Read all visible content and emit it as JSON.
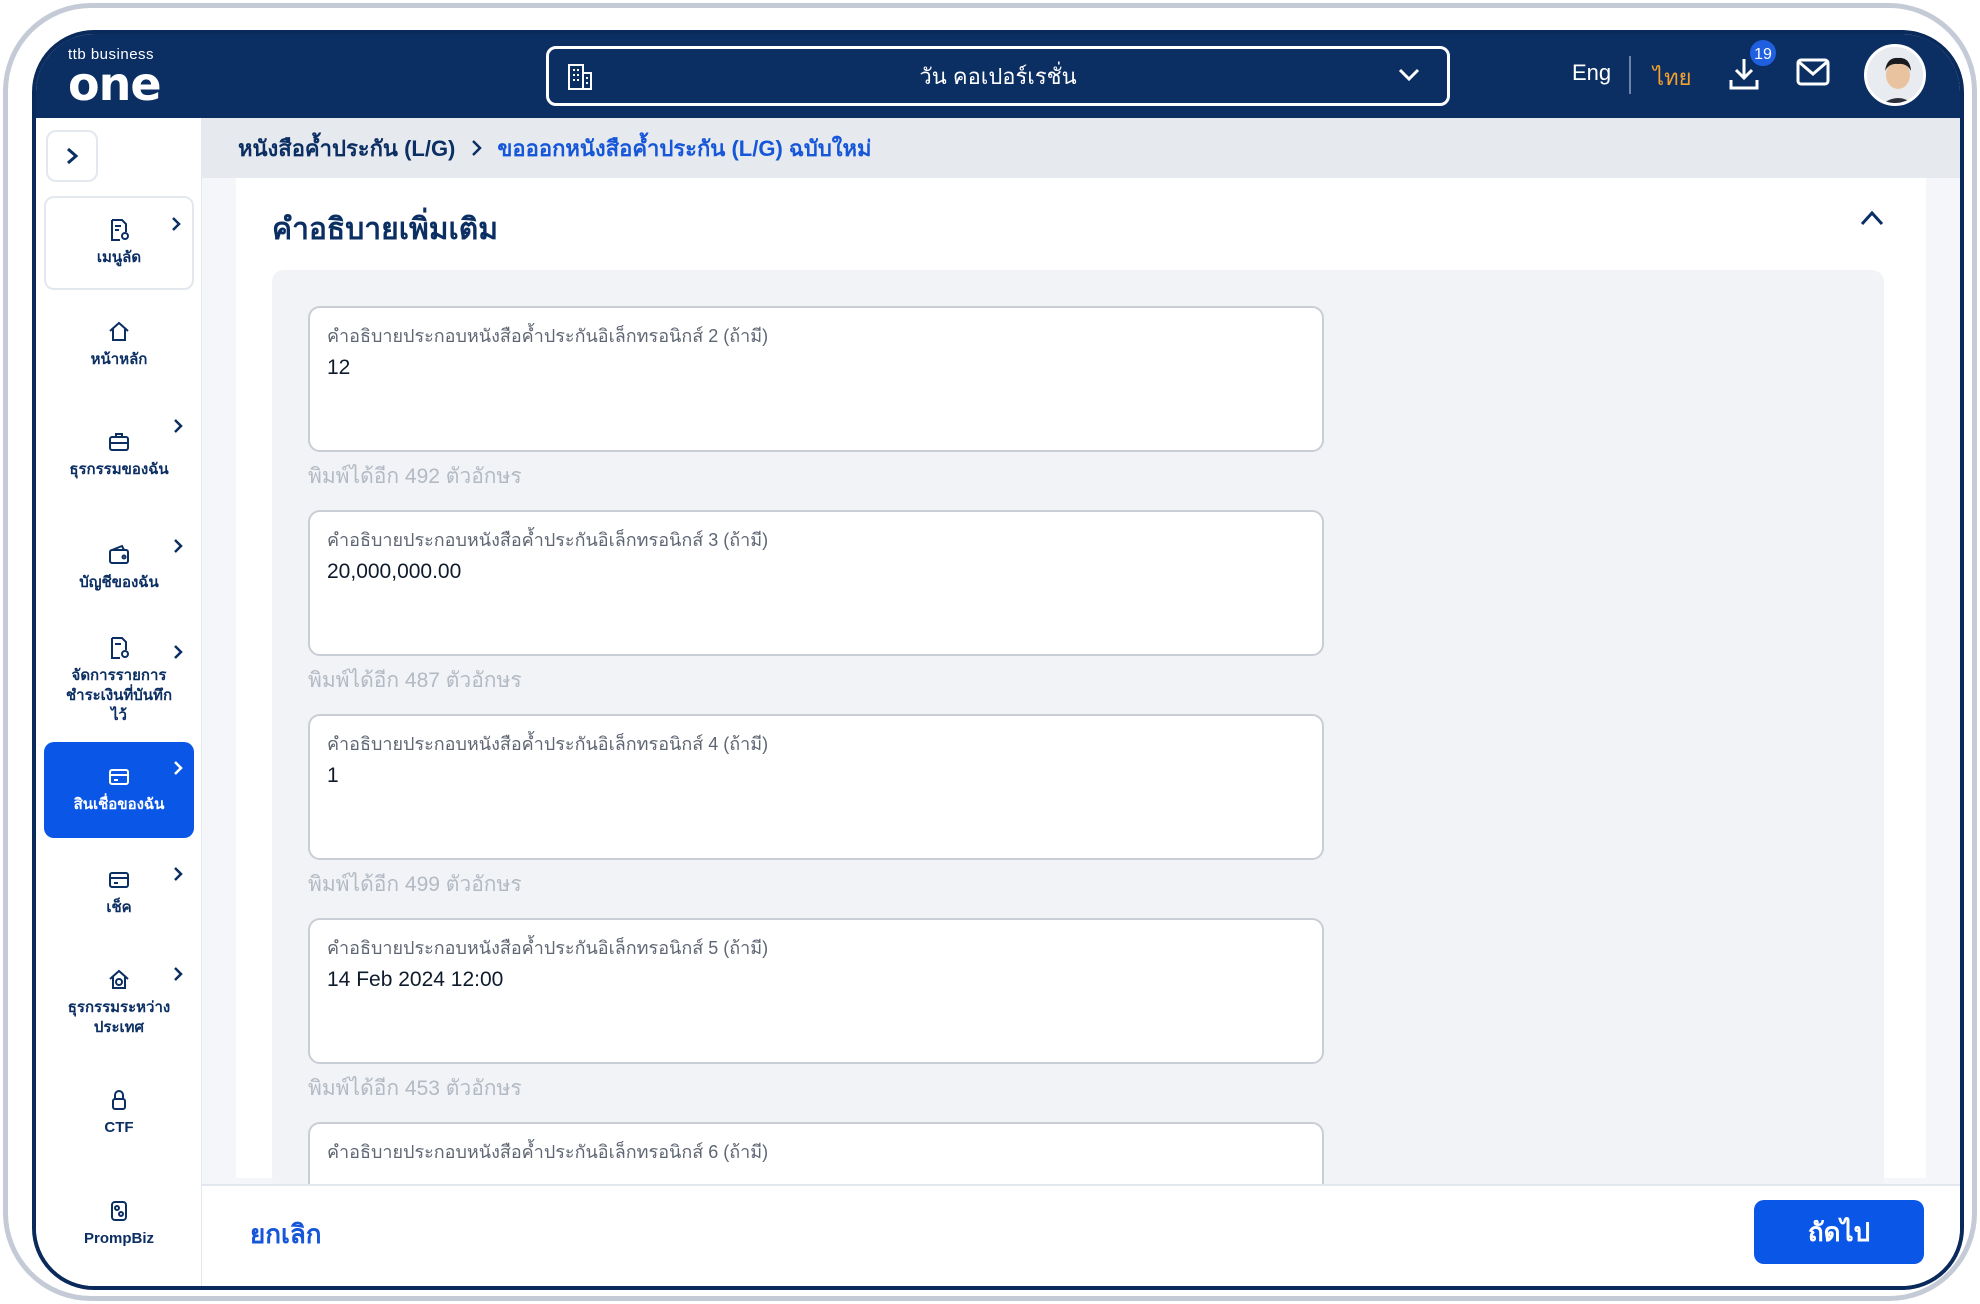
{
  "header": {
    "logo_top": "ttb business",
    "logo_main": "one",
    "company_name": "วัน คอเปอร์เรชั่น",
    "lang_en": "Eng",
    "lang_th": "ไทย",
    "download_count": "19"
  },
  "sidebar": {
    "items": [
      {
        "label": "เมนูลัด",
        "icon": "document-edit-icon",
        "has_arrow": true
      },
      {
        "label": "หน้าหลัก",
        "icon": "home-icon",
        "has_arrow": false
      },
      {
        "label": "ธุรกรรมของฉัน",
        "icon": "briefcase-icon",
        "has_arrow": true
      },
      {
        "label": "บัญชีของฉัน",
        "icon": "wallet-icon",
        "has_arrow": true
      },
      {
        "label": "จัดการรายการชำระเงินที่บันทึกไว้",
        "icon": "document-gear-icon",
        "has_arrow": true
      },
      {
        "label": "สินเชื่อของฉัน",
        "icon": "loan-icon",
        "has_arrow": true
      },
      {
        "label": "เช็ค",
        "icon": "cheque-icon",
        "has_arrow": true
      },
      {
        "label": "ธุรกรรมระหว่างประเทศ",
        "icon": "international-icon",
        "has_arrow": true
      },
      {
        "label": "CTF",
        "icon": "lock-icon",
        "has_arrow": false
      },
      {
        "label": "PrompBiz",
        "icon": "prompbiz-icon",
        "has_arrow": false
      }
    ]
  },
  "breadcrumb": {
    "parent": "หนังสือค้ำประกัน (L/G)",
    "current": "ขอออกหนังสือค้ำประกัน (L/G) ฉบับใหม่"
  },
  "section": {
    "title": "คำอธิบายเพิ่มเติม",
    "fields": [
      {
        "label": "คำอธิบายประกอบหนังสือค้ำประกันอิเล็กทรอนิกส์ 2 (ถ้ามี)",
        "value": "12",
        "help": "พิมพ์ได้อีก 492 ตัวอักษร"
      },
      {
        "label": "คำอธิบายประกอบหนังสือค้ำประกันอิเล็กทรอนิกส์ 3 (ถ้ามี)",
        "value": "20,000,000.00",
        "help": "พิมพ์ได้อีก 487 ตัวอักษร"
      },
      {
        "label": "คำอธิบายประกอบหนังสือค้ำประกันอิเล็กทรอนิกส์ 4 (ถ้ามี)",
        "value": "1",
        "help": "พิมพ์ได้อีก 499 ตัวอักษร"
      },
      {
        "label": "คำอธิบายประกอบหนังสือค้ำประกันอิเล็กทรอนิกส์ 5 (ถ้ามี)",
        "value": "14 Feb 2024 12:00",
        "help": "พิมพ์ได้อีก 453 ตัวอักษร"
      },
      {
        "label": "คำอธิบายประกอบหนังสือค้ำประกันอิเล็กทรอนิกส์ 6 (ถ้ามี)",
        "value": "",
        "help": ""
      }
    ]
  },
  "footer": {
    "cancel_label": "ยกเลิก",
    "next_label": "ถัดไป"
  },
  "colors": {
    "header_bg": "#0b2e63",
    "accent": "#0a56e6",
    "lang_active": "#f4a12c"
  }
}
